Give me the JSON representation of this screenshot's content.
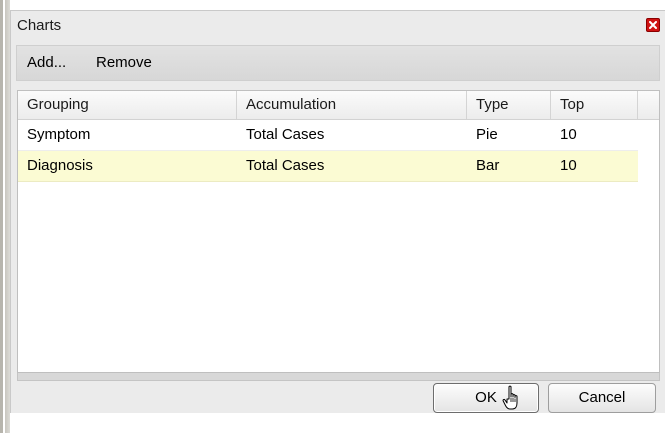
{
  "window": {
    "title": "Charts"
  },
  "toolbar": {
    "add_label": "Add...",
    "remove_label": "Remove"
  },
  "grid": {
    "columns": [
      "Grouping",
      "Accumulation",
      "Type",
      "Top"
    ],
    "rows": [
      {
        "grouping": "Symptom",
        "accumulation": "Total Cases",
        "type": "Pie",
        "top": "10",
        "selected": false
      },
      {
        "grouping": "Diagnosis",
        "accumulation": "Total Cases",
        "type": "Bar",
        "top": "10",
        "selected": true
      }
    ]
  },
  "buttons": {
    "ok_label": "OK",
    "cancel_label": "Cancel"
  },
  "icons": {
    "close": "close-icon",
    "cursor": "hand-pointer-cursor-icon"
  },
  "colors": {
    "close_button": "#d01212",
    "selected_row": "#fbfbd3"
  }
}
